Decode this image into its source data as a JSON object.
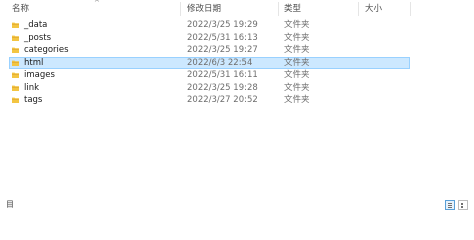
{
  "columns": {
    "name": "名称",
    "modified": "修改日期",
    "type": "类型",
    "size": "大小"
  },
  "sort_indicator": "^",
  "rows": [
    {
      "name": "_data",
      "modified": "2022/3/25 19:29",
      "type": "文件夹"
    },
    {
      "name": "_posts",
      "modified": "2022/5/31 16:13",
      "type": "文件夹"
    },
    {
      "name": "categories",
      "modified": "2022/3/25 19:27",
      "type": "文件夹"
    },
    {
      "name": "html",
      "modified": "2022/6/3 22:54",
      "type": "文件夹"
    },
    {
      "name": "images",
      "modified": "2022/5/31 16:11",
      "type": "文件夹"
    },
    {
      "name": "link",
      "modified": "2022/3/25 19:28",
      "type": "文件夹"
    },
    {
      "name": "tags",
      "modified": "2022/3/27 20:52",
      "type": "文件夹"
    }
  ],
  "selected_row": "html",
  "status": {
    "text": "目"
  },
  "colors": {
    "folder": "#f3c542",
    "folder_dark": "#e0a82e",
    "selection_bg": "#cce8ff",
    "selection_border": "#99d1ff"
  },
  "icons": {
    "folder": "folder-icon",
    "details_view": "details-view-icon",
    "tiles_view": "tiles-view-icon"
  }
}
